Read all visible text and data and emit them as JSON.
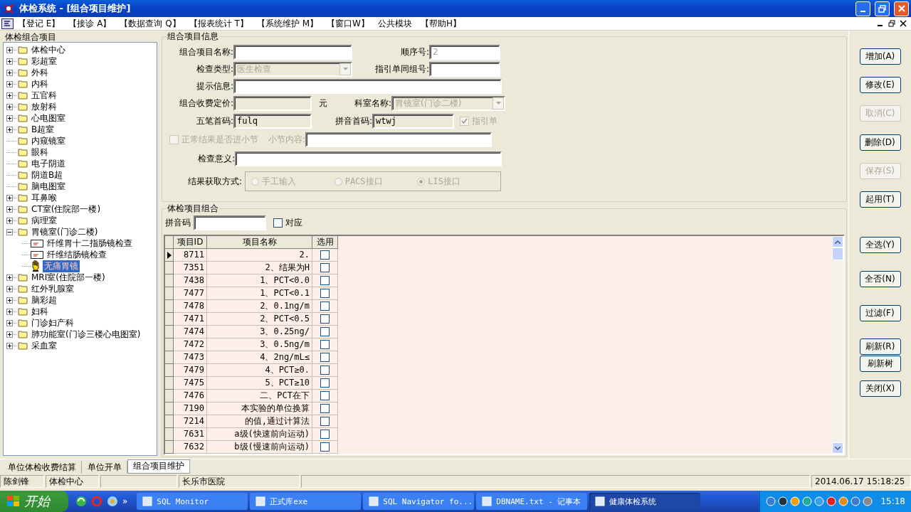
{
  "window": {
    "title": "体检系统 - [组合项目维护]"
  },
  "menu": [
    "【登记 E】",
    "【接诊 A】",
    "【数据查询 Q】",
    "【报表统计 T】",
    "【系统维护 M】",
    "【窗口W】",
    "公共模块",
    "【帮助H】"
  ],
  "tree_panel": {
    "title": "体检组合项目",
    "nodes": [
      {
        "label": "体检中心",
        "expanded": false,
        "selected": false
      },
      {
        "label": "彩超室",
        "expanded": false,
        "selected": false
      },
      {
        "label": "外科",
        "expanded": false,
        "selected": false
      },
      {
        "label": "内科",
        "expanded": false,
        "selected": false
      },
      {
        "label": "五官科",
        "expanded": false,
        "selected": false
      },
      {
        "label": "放射科",
        "expanded": false,
        "selected": false
      },
      {
        "label": "心电图室",
        "expanded": false,
        "selected": false
      },
      {
        "label": "B超室",
        "expanded": false,
        "selected": false
      },
      {
        "label": "内窥镜室",
        "selected": false
      },
      {
        "label": "眼科",
        "selected": false
      },
      {
        "label": "电子阴道",
        "selected": false
      },
      {
        "label": "阴道B超",
        "selected": false
      },
      {
        "label": "脑电图室",
        "selected": false
      },
      {
        "label": "耳鼻喉",
        "expanded": false,
        "selected": false
      },
      {
        "label": "CT室(住院部一楼)",
        "expanded": false,
        "selected": false
      },
      {
        "label": "病理室",
        "expanded": false,
        "selected": false
      },
      {
        "label": "胃镜室(门诊二楼)",
        "expanded": true,
        "selected": false,
        "children": [
          {
            "label": "纤维胃十二指肠镜检查",
            "kind": "card",
            "selected": false
          },
          {
            "label": "纤维结肠镜检查",
            "kind": "card",
            "selected": false
          },
          {
            "label": "无痛胃镜",
            "kind": "hand",
            "selected": true
          }
        ]
      },
      {
        "label": "MRI室(住院部一楼)",
        "expanded": false,
        "selected": false
      },
      {
        "label": "红外乳腺室",
        "expanded": false,
        "selected": false
      },
      {
        "label": "脑彩超",
        "expanded": false,
        "selected": false
      },
      {
        "label": "妇科",
        "expanded": false,
        "selected": false
      },
      {
        "label": "门诊妇产科",
        "expanded": false,
        "selected": false
      },
      {
        "label": "肺功能室(门诊三楼心电图室)",
        "expanded": false,
        "selected": false
      },
      {
        "label": "采血室",
        "expanded": false,
        "selected": false
      }
    ]
  },
  "combo_info": {
    "title": "组合项目信息",
    "item_name": {
      "label": "组合项目名称:"
    },
    "order_no": {
      "label": "顺序号:",
      "value": "2",
      "disabled": true
    },
    "exam_type": {
      "label": "检查类型:",
      "value": "医生检查",
      "disabled": true
    },
    "guide_group": {
      "label": "指引单同组号:"
    },
    "hint": {
      "label": "提示信息:"
    },
    "price": {
      "label": "组合收费定价:",
      "readonly": true,
      "unit": "元"
    },
    "dept": {
      "label": "科室名称:",
      "value": "胃镜室(门诊二楼)",
      "disabled": true
    },
    "wubi": {
      "label": "五笔首码:",
      "value": "fulq",
      "readonly": true
    },
    "pinyin": {
      "label": "拼音首码:",
      "value": "wtwj",
      "readonly": true
    },
    "guide_sheet": {
      "label": "指引单",
      "checked": true,
      "disabled": true
    },
    "normal_section": {
      "label": "正常结果是否进小节",
      "checked": false,
      "disabled": true
    },
    "section_content": {
      "label": "小节内容:",
      "disabled": true
    },
    "meaning": {
      "label": "检查意义:"
    },
    "result_mode": {
      "label": "结果获取方式:",
      "options": [
        {
          "label": "手工输入",
          "selected": false,
          "disabled": true
        },
        {
          "label": "PACS接口",
          "selected": false,
          "disabled": true
        },
        {
          "label": "LIS接口",
          "selected": true,
          "disabled": true
        }
      ]
    }
  },
  "items_panel": {
    "title": "体检项目组合",
    "search": {
      "label": "拼音码"
    },
    "match": {
      "label": "对应",
      "checked": false
    },
    "columns": [
      "项目ID",
      "项目名称",
      "选用"
    ],
    "rows": [
      {
        "id": "8711",
        "name": "2.",
        "checked": false,
        "current": true
      },
      {
        "id": "7351",
        "name": "2、结果为H",
        "checked": false,
        "current": false
      },
      {
        "id": "7438",
        "name": "1、PCT<0.0",
        "checked": false,
        "current": false
      },
      {
        "id": "7477",
        "name": "1、PCT<0.1",
        "checked": false,
        "current": false
      },
      {
        "id": "7478",
        "name": "2、0.1ng/m",
        "checked": false,
        "current": false
      },
      {
        "id": "7471",
        "name": "2、PCT<0.5",
        "checked": false,
        "current": false
      },
      {
        "id": "7474",
        "name": "3、0.25ng/",
        "checked": false,
        "current": false
      },
      {
        "id": "7472",
        "name": "3、0.5ng/m",
        "checked": false,
        "current": false
      },
      {
        "id": "7473",
        "name": "4、2ng/mL≤",
        "checked": false,
        "current": false
      },
      {
        "id": "7479",
        "name": "4、PCT≥0.",
        "checked": false,
        "current": false
      },
      {
        "id": "7475",
        "name": "5、PCT≥10",
        "checked": false,
        "current": false
      },
      {
        "id": "7476",
        "name": "二、PCT在下",
        "checked": false,
        "current": false
      },
      {
        "id": "7190",
        "name": "本实验的单位换算",
        "checked": false,
        "current": false
      },
      {
        "id": "7214",
        "name": "的值,通过计算法",
        "checked": false,
        "current": false
      },
      {
        "id": "7631",
        "name": "a级(快速前向运动)",
        "checked": false,
        "current": false
      },
      {
        "id": "7632",
        "name": "b级(慢速前向运动)",
        "checked": false,
        "current": false
      }
    ]
  },
  "actions": [
    {
      "label": "增加(A)",
      "disabled": false
    },
    {
      "label": "修改(E)",
      "disabled": false
    },
    {
      "label": "取消(C)",
      "disabled": true
    },
    {
      "label": "删除(D)",
      "disabled": false
    },
    {
      "label": "保存(S)",
      "disabled": true
    },
    {
      "label": "起用(T)",
      "disabled": false
    },
    {
      "label": "全选(Y)",
      "disabled": false
    },
    {
      "label": "全否(N)",
      "disabled": false
    },
    {
      "label": "过滤(F)",
      "disabled": false
    },
    {
      "label": "刷新(R)",
      "disabled": false
    },
    {
      "label": "刷新树",
      "disabled": false
    },
    {
      "label": "关闭(X)",
      "disabled": false
    }
  ],
  "doc_tabs": [
    {
      "label": "单位体检收费结算",
      "selected": false
    },
    {
      "label": "单位开单",
      "selected": false
    },
    {
      "label": "组合项目维护",
      "selected": true
    }
  ],
  "status_bar": {
    "user": "陈剑锋",
    "department": "体检中心",
    "hospital": "长乐市医院",
    "datetime": "2014.06.17 15:18:25"
  },
  "taskbar": {
    "start": "开始",
    "more": "»",
    "tasks": [
      {
        "label": "SQL Monitor",
        "selected": false
      },
      {
        "label": "正式库exe",
        "selected": false
      },
      {
        "label": "SQL Navigator fo...",
        "selected": false
      },
      {
        "label": "DBNAME.txt - 记事本",
        "selected": false
      },
      {
        "label": "健康体检系统",
        "selected": true
      }
    ],
    "clock": "15:18"
  }
}
